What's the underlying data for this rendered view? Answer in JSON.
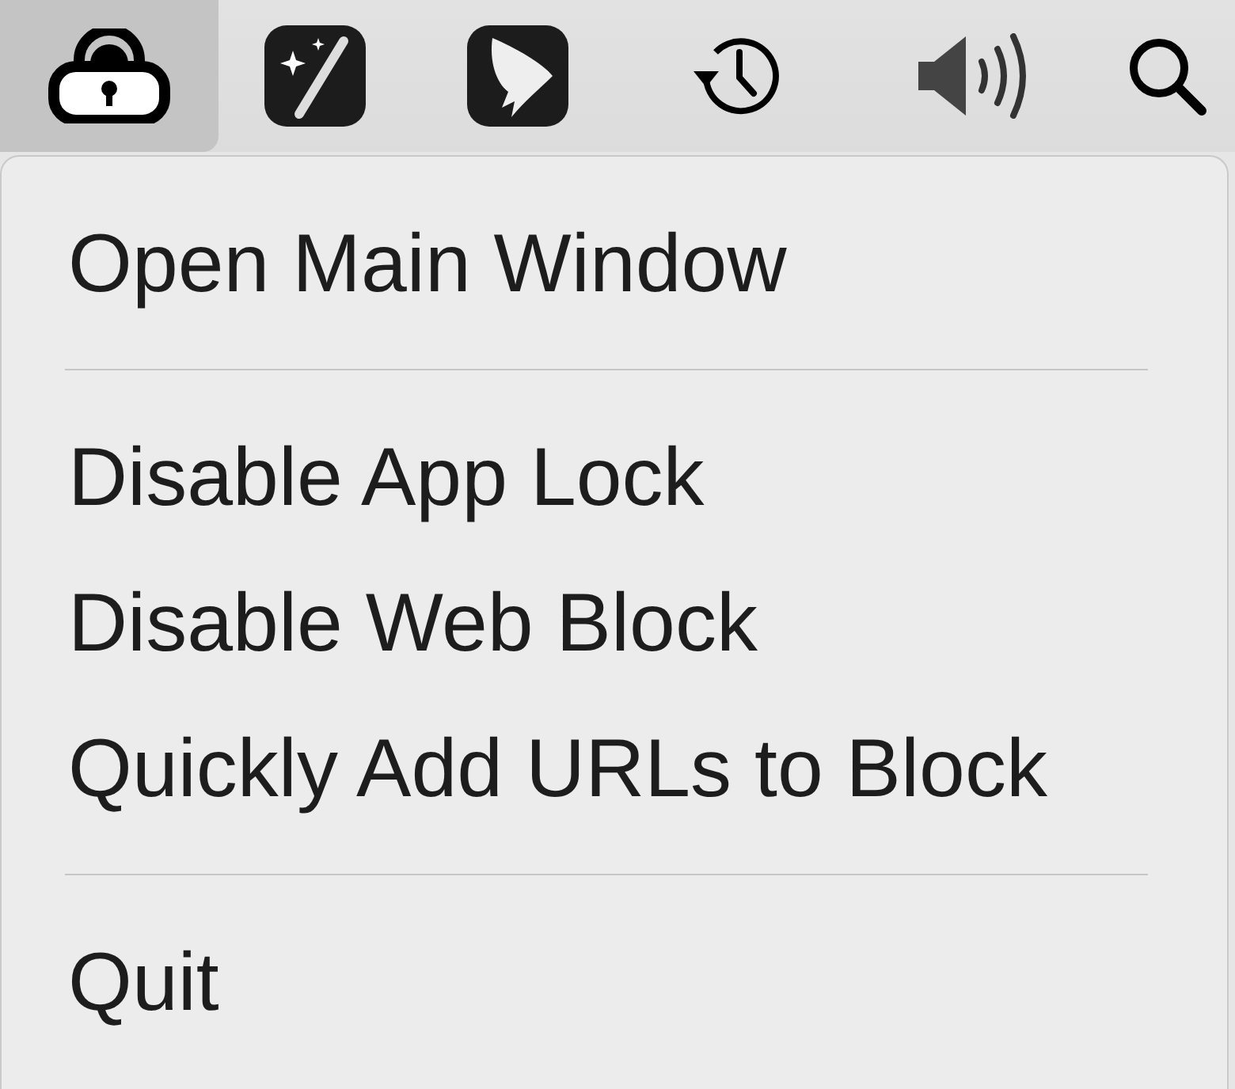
{
  "menu_bar": {
    "icons": [
      {
        "kind": "lock",
        "selected": true
      },
      {
        "kind": "wand",
        "selected": false
      },
      {
        "kind": "wing",
        "selected": false
      },
      {
        "kind": "clock",
        "selected": false
      },
      {
        "kind": "speaker",
        "selected": false
      },
      {
        "kind": "search",
        "selected": false
      }
    ]
  },
  "menu": {
    "items": [
      {
        "kind": "item",
        "label": "Open Main Window"
      },
      {
        "kind": "separator"
      },
      {
        "kind": "item",
        "label": "Disable App Lock"
      },
      {
        "kind": "item",
        "label": "Disable Web Block"
      },
      {
        "kind": "item",
        "label": "Quickly Add URLs to Block"
      },
      {
        "kind": "separator"
      },
      {
        "kind": "item",
        "label": "Quit"
      }
    ]
  }
}
